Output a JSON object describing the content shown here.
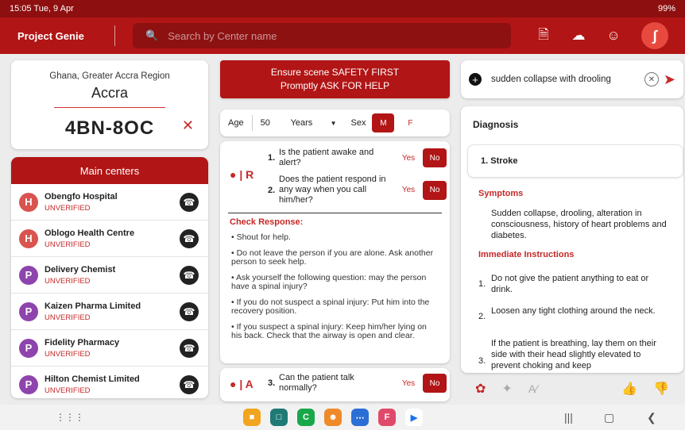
{
  "status_bar": {
    "time": "15:05 Tue, 9 Apr",
    "right": "99%"
  },
  "app": {
    "title": "Project Genie",
    "search_placeholder": "Search by Center name"
  },
  "location": {
    "region": "Ghana, Greater Accra Region",
    "city": "Accra",
    "code": "4BN-8OC"
  },
  "centers": {
    "header": "Main centers",
    "items": [
      {
        "initial": "H",
        "color": "#d9534f",
        "name": "Obengfo Hospital",
        "status": "UNVERIFIED"
      },
      {
        "initial": "H",
        "color": "#d9534f",
        "name": "Oblogo Health Centre",
        "status": "UNVERIFIED"
      },
      {
        "initial": "P",
        "color": "#8e44ad",
        "name": "Delivery Chemist",
        "status": "UNVERIFIED"
      },
      {
        "initial": "P",
        "color": "#8e44ad",
        "name": "Kaizen Pharma Limited",
        "status": "UNVERIFIED"
      },
      {
        "initial": "P",
        "color": "#8e44ad",
        "name": "Fidelity Pharmacy",
        "status": "UNVERIFIED"
      },
      {
        "initial": "P",
        "color": "#8e44ad",
        "name": "Hilton Chemist Limited",
        "status": "UNVERIFIED"
      }
    ]
  },
  "banner": {
    "line1": "Ensure scene SAFETY FIRST",
    "line2": "Promptly ASK FOR HELP"
  },
  "patient": {
    "age_label": "Age",
    "age": "50",
    "unit": "Years",
    "sex_label": "Sex",
    "male": "M",
    "female": "F"
  },
  "questions": {
    "badge": "R",
    "q1": {
      "num": "1.",
      "text": "Is the patient awake and alert?"
    },
    "q2": {
      "num": "2.",
      "text": "Does the patient respond in any way when you call him/her?"
    },
    "yes": "Yes",
    "no": "No",
    "response_title": "Check Response:",
    "steps": [
      "• Shout for help.",
      "• Do not leave the person if you are alone. Ask another person to seek help.",
      "• Ask yourself the following question: may the person have a spinal injury?",
      "• If you do not suspect a spinal injury: Put him into the recovery position.",
      "• If you suspect a spinal injury: Keep him/her lying on his back. Check that the airway is open and clear."
    ],
    "q3_badge": "A",
    "q3": {
      "num": "3.",
      "text": "Can the patient talk normally?"
    }
  },
  "symptom_input": {
    "value": "sudden collapse with drooling"
  },
  "diagnosis": {
    "header": "Diagnosis",
    "result": "1.  Stroke",
    "symptoms_title": "Symptoms",
    "symptoms_text": "Sudden collapse, drooling, alteration in consciousness, history of heart problems and diabetes.",
    "instructions_title": "Immediate Instructions",
    "instructions": [
      {
        "n": "1.",
        "t": "Do not give the patient anything to eat or drink."
      },
      {
        "n": "2.",
        "t": "Loosen any tight clothing around the neck."
      },
      {
        "n": "3.",
        "t": "If the patient is breathing, lay them on their side with their head slightly elevated to prevent choking and keep"
      }
    ]
  },
  "icons": {
    "accent": "#b21515",
    "app_bar": [
      "export-icon",
      "upload-icon",
      "face-icon",
      "avatar-icon"
    ],
    "diagnosis_bar": [
      "openai-icon",
      "sparkle-icon",
      "translate-icon",
      "thumbs-up-icon",
      "thumbs-down-icon"
    ]
  }
}
